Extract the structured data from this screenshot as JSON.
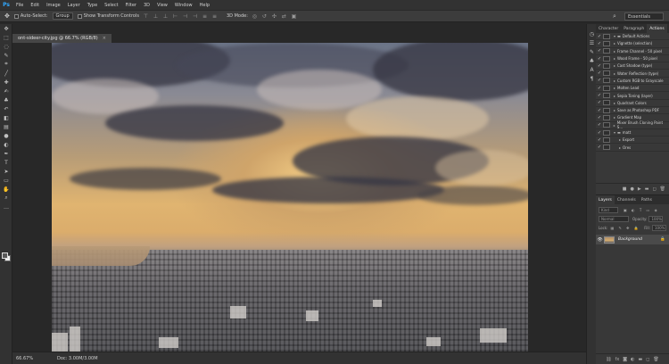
{
  "app": {
    "logo": "Ps"
  },
  "menu": [
    "File",
    "Edit",
    "Image",
    "Layer",
    "Type",
    "Select",
    "Filter",
    "3D",
    "View",
    "Window",
    "Help"
  ],
  "options_bar": {
    "auto_select_label": "Auto-Select:",
    "auto_select_value": "Group",
    "show_transform_label": "Show Transform Controls",
    "mode_label": "3D Mode:",
    "workspace": "Essentials"
  },
  "document": {
    "tab_title": "ont-sideer-city.jpg @ 66.7% (RGB/8)",
    "zoom": "66.67%",
    "doc_info": "Doc: 3.00M/3.00M"
  },
  "right_strip_tabs": [
    "Character",
    "Paragraph",
    "Actions"
  ],
  "actions": [
    {
      "toggle": "✓",
      "expand": "▾",
      "label": "Default Actions",
      "folder": true
    },
    {
      "toggle": "✓",
      "expand": "▸",
      "label": "Vignette (selection)"
    },
    {
      "toggle": "✓",
      "expand": "▸",
      "label": "Frame Channel - 50 pixel"
    },
    {
      "toggle": "✓",
      "expand": "▸",
      "label": "Wood Frame - 50 pixel"
    },
    {
      "toggle": "✓",
      "expand": "▸",
      "label": "Cast Shadow (type)"
    },
    {
      "toggle": "✓",
      "expand": "▸",
      "label": "Water Reflection (type)"
    },
    {
      "toggle": "✓",
      "expand": "▸",
      "label": "Custom RGB to Grayscale"
    },
    {
      "toggle": "✓",
      "expand": "▸",
      "label": "Molten Lead"
    },
    {
      "toggle": "✓",
      "expand": "▸",
      "label": "Sepia Toning (layer)"
    },
    {
      "toggle": "✓",
      "expand": "▸",
      "label": "Quadrant Colors"
    },
    {
      "toggle": "✓",
      "expand": "▸",
      "label": "Save as Photoshop PDF"
    },
    {
      "toggle": "✓",
      "expand": "▸",
      "label": "Gradient Map"
    },
    {
      "toggle": "✓",
      "expand": "▸",
      "label": "Mixer Brush Cloning Paint S..."
    },
    {
      "toggle": "✓",
      "expand": "▾",
      "label": "matt",
      "folder": true
    },
    {
      "toggle": "✓",
      "expand": "▸",
      "label": "Export",
      "indent": true
    },
    {
      "toggle": "✓",
      "expand": "▸",
      "label": "Ores",
      "indent": true
    }
  ],
  "layers_panel": {
    "tabs": [
      "Layers",
      "Channels",
      "Paths"
    ],
    "kind": "Kind",
    "blend": "Normal",
    "opacity_label": "Opacity:",
    "opacity_value": "100%",
    "lock_label": "Lock:",
    "fill_label": "Fill:",
    "fill_value": "100%",
    "layers": [
      {
        "name": "Background",
        "visible": true,
        "locked": true
      }
    ]
  }
}
